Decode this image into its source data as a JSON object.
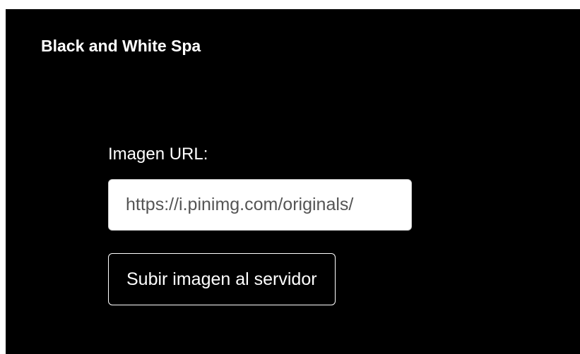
{
  "app": {
    "title": "Black and White Spa"
  },
  "form": {
    "url_label": "Imagen URL:",
    "url_value": "https://i.pinimg.com/originals/",
    "upload_button_label": "Subir imagen al servidor"
  },
  "colors": {
    "background": "#000000",
    "text": "#ffffff",
    "input_background": "#ffffff"
  }
}
